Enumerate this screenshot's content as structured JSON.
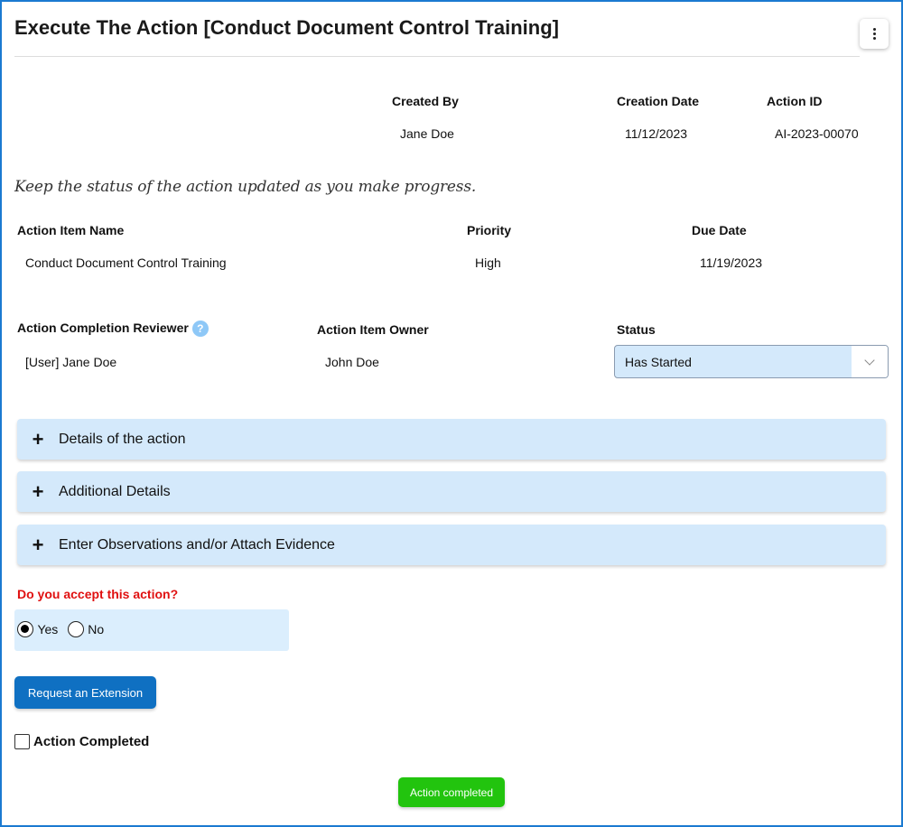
{
  "header": {
    "title": "Execute The Action [Conduct Document Control Training]",
    "menu_icon": "more-vertical-icon"
  },
  "meta": {
    "created_by_label": "Created By",
    "created_by": "Jane Doe",
    "creation_date_label": "Creation Date",
    "creation_date": "11/12/2023",
    "action_id_label": "Action ID",
    "action_id": "AI-2023-00070"
  },
  "hint": "Keep the status of the action updated as you make progress.",
  "item": {
    "name_label": "Action Item Name",
    "name": "Conduct Document Control Training",
    "priority_label": "Priority",
    "priority": "High",
    "due_label": "Due Date",
    "due": "11/19/2023"
  },
  "people": {
    "reviewer_label": "Action Completion Reviewer",
    "reviewer_help": "?",
    "reviewer": "[User] Jane Doe",
    "owner_label": "Action Item Owner",
    "owner": "John Doe",
    "status_label": "Status",
    "status_value": "Has Started"
  },
  "accordions": [
    {
      "icon": "+",
      "label": "Details of the action"
    },
    {
      "icon": "+",
      "label": "Additional Details"
    },
    {
      "icon": "+",
      "label": "Enter Observations and/or Attach Evidence"
    }
  ],
  "accept": {
    "question": "Do you accept this action?",
    "yes_label": "Yes",
    "no_label": "No",
    "selected": "Yes"
  },
  "buttons": {
    "request_extension": "Request an Extension",
    "action_completed_btn": "Action completed"
  },
  "checkbox": {
    "label": "Action Completed",
    "checked": false
  },
  "colors": {
    "frame": "#1b7ad1",
    "panel_bg": "#d4e9fb",
    "question_red": "#e01010",
    "primary_blue": "#0f70c2",
    "success_green": "#22c40e"
  }
}
